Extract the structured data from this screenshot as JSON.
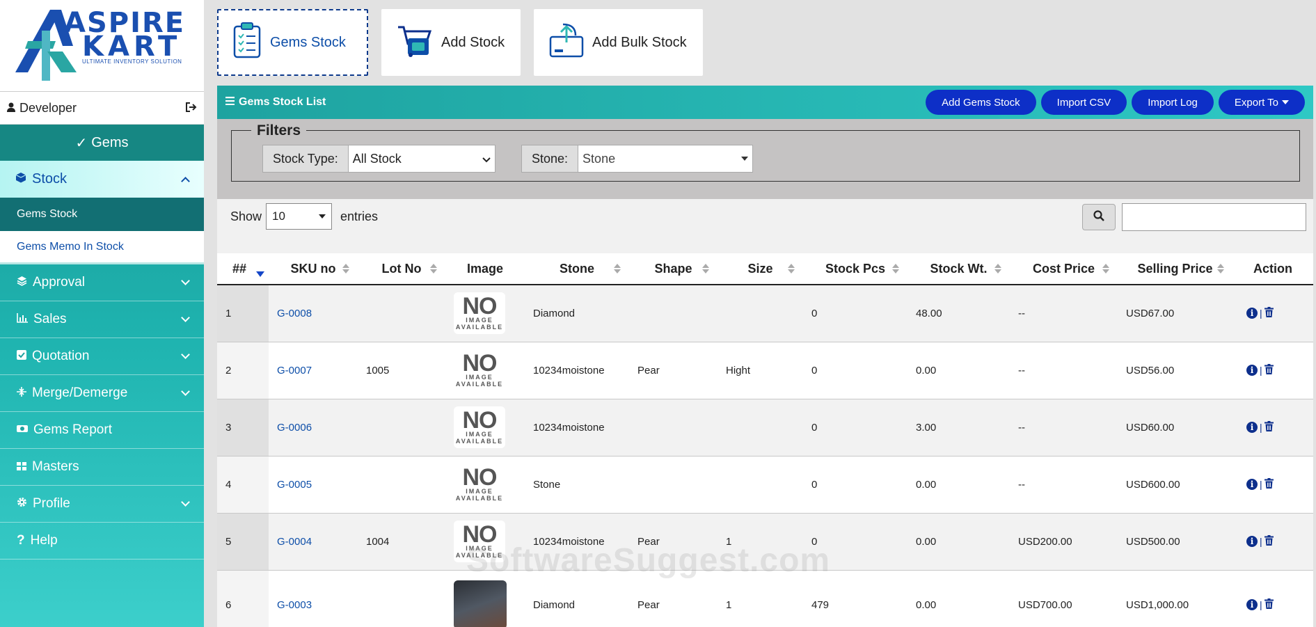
{
  "logo": {
    "line1": "ASPIRE",
    "line2": "KART",
    "tagline": "ULTIMATE INVENTORY SOLUTION"
  },
  "user": {
    "name": "Developer"
  },
  "sidebar": {
    "gems": "Gems",
    "stock": "Stock",
    "stock_sub": [
      "Gems Stock",
      "Gems Memo In Stock"
    ],
    "items": [
      {
        "label": "Approval",
        "icon": "layers-icon",
        "chevron": true
      },
      {
        "label": "Sales",
        "icon": "chart-icon",
        "chevron": true
      },
      {
        "label": "Quotation",
        "icon": "checkbox-icon",
        "chevron": true
      },
      {
        "label": "Merge/Demerge",
        "icon": "merge-icon",
        "chevron": true
      },
      {
        "label": "Gems Report",
        "icon": "report-icon",
        "chevron": false
      },
      {
        "label": "Masters",
        "icon": "grid-icon",
        "chevron": false
      },
      {
        "label": "Profile",
        "icon": "gear-icon",
        "chevron": true
      },
      {
        "label": "Help",
        "icon": "question-icon",
        "chevron": false
      }
    ]
  },
  "topnav": {
    "gems_stock": "Gems Stock",
    "add_stock": "Add Stock",
    "add_bulk_stock": "Add Bulk Stock"
  },
  "panel": {
    "title": "Gems Stock List",
    "buttons": {
      "add_gems_stock": "Add Gems Stock",
      "import_csv": "Import CSV",
      "import_log": "Import Log",
      "export_to": "Export To"
    }
  },
  "filters": {
    "legend": "Filters",
    "stock_type_label": "Stock Type:",
    "stock_type_value": "All Stock",
    "stone_label": "Stone:",
    "stone_value": "Stone"
  },
  "list": {
    "show_label": "Show",
    "entries_value": "10",
    "entries_label": "entries"
  },
  "table": {
    "headers": [
      "##",
      "SKU no",
      "Lot No",
      "Image",
      "Stone",
      "Shape",
      "Size",
      "Stock Pcs",
      "Stock Wt.",
      "Cost Price",
      "Selling Price",
      "Action"
    ],
    "no_image": {
      "big": "NO",
      "small1": "IMAGE",
      "small2": "AVAILABLE"
    },
    "rows": [
      {
        "n": "1",
        "sku": "G-0008",
        "lot": "",
        "image": "none",
        "stone": "Diamond",
        "shape": "",
        "size": "",
        "pcs": "0",
        "wt": "48.00",
        "cost": "--",
        "sell": "USD67.00"
      },
      {
        "n": "2",
        "sku": "G-0007",
        "lot": "1005",
        "image": "none",
        "stone": "10234moistone",
        "shape": "Pear",
        "size": "Hight",
        "pcs": "0",
        "wt": "0.00",
        "cost": "--",
        "sell": "USD56.00"
      },
      {
        "n": "3",
        "sku": "G-0006",
        "lot": "",
        "image": "none",
        "stone": "10234moistone",
        "shape": "",
        "size": "",
        "pcs": "0",
        "wt": "3.00",
        "cost": "--",
        "sell": "USD60.00"
      },
      {
        "n": "4",
        "sku": "G-0005",
        "lot": "",
        "image": "none",
        "stone": "Stone",
        "shape": "",
        "size": "",
        "pcs": "0",
        "wt": "0.00",
        "cost": "--",
        "sell": "USD600.00"
      },
      {
        "n": "5",
        "sku": "G-0004",
        "lot": "1004",
        "image": "none",
        "stone": "10234moistone",
        "shape": "Pear",
        "size": "1",
        "pcs": "0",
        "wt": "0.00",
        "cost": "USD200.00",
        "sell": "USD500.00"
      },
      {
        "n": "6",
        "sku": "G-0003",
        "lot": "",
        "image": "photo",
        "stone": "Diamond",
        "shape": "Pear",
        "size": "1",
        "pcs": "479",
        "wt": "0.00",
        "cost": "USD700.00",
        "sell": "USD1,000.00"
      }
    ]
  },
  "watermark": "SoftwareSuggest.com",
  "colors": {
    "accent_teal": "#1ea3a0",
    "button_blue": "#0d2fc7",
    "link_blue": "#0d4ea8"
  }
}
